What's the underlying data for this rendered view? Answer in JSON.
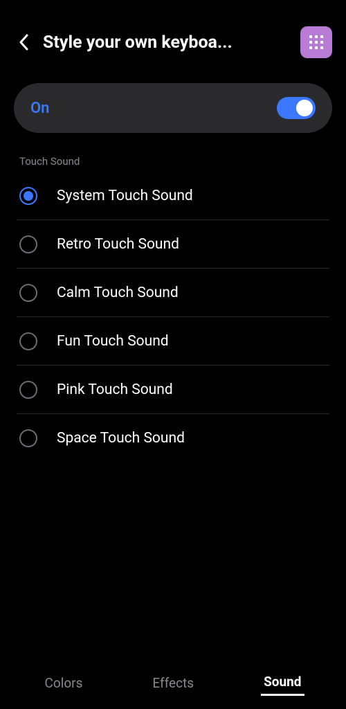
{
  "header": {
    "title": "Style your own keyboa..."
  },
  "toggle": {
    "label": "On",
    "enabled": true
  },
  "section": {
    "label": "Touch Sound"
  },
  "options": [
    {
      "label": "System Touch Sound",
      "selected": true
    },
    {
      "label": "Retro Touch Sound",
      "selected": false
    },
    {
      "label": "Calm Touch Sound",
      "selected": false
    },
    {
      "label": "Fun Touch Sound",
      "selected": false
    },
    {
      "label": "Pink Touch Sound",
      "selected": false
    },
    {
      "label": "Space Touch Sound",
      "selected": false
    }
  ],
  "tabs": [
    {
      "label": "Colors",
      "active": false
    },
    {
      "label": "Effects",
      "active": false
    },
    {
      "label": "Sound",
      "active": true
    }
  ]
}
